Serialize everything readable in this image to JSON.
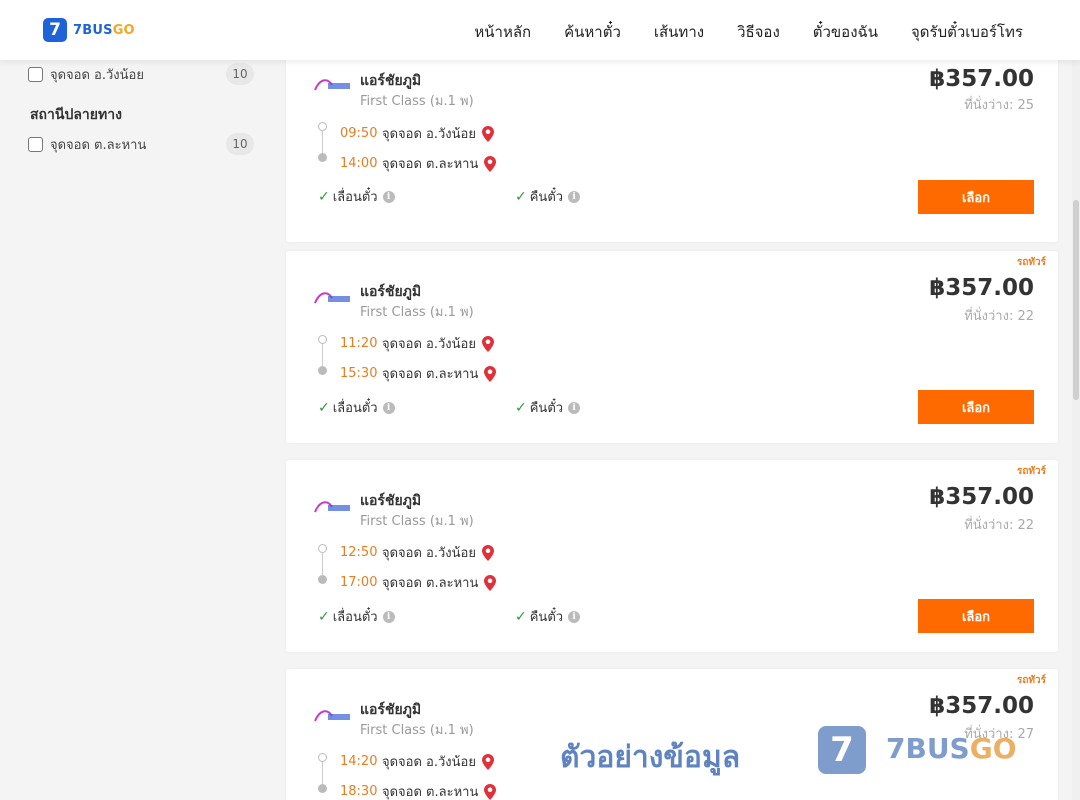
{
  "header": {
    "logo_mark": "7",
    "logo_text": "7BUS",
    "logo_text_accent": "GO",
    "nav": [
      "หน้าหลัก",
      "ค้นหาตั๋ว",
      "เส้นทาง",
      "วิธีจอง",
      "ตั๋วของฉัน",
      "จุดรับตั๋วเบอร์โทร"
    ]
  },
  "sidebar": {
    "origin_item": {
      "label": "จุดจอด อ.วังน้อย",
      "count": "10"
    },
    "destination_title": "สถานีปลายทาง",
    "destination_item": {
      "label": "จุดจอด ต.ละหาน",
      "count": "10"
    }
  },
  "cards": [
    {
      "operator": "แอร์ชัยภูมิ",
      "class": "First Class (ม.1 พ)",
      "tag": "",
      "price": "฿357.00",
      "seats": "ที่นั่งว่าง: 25",
      "dep_time": "09:50",
      "dep_place": "จุดจอด อ.วังน้อย",
      "arr_time": "14:00",
      "arr_place": "จุดจอด ต.ละหาน",
      "feature1": "เลื่อนตั๋ว",
      "feature2": "คืนตั๋ว",
      "button": "เลือก"
    },
    {
      "operator": "แอร์ชัยภูมิ",
      "class": "First Class (ม.1 พ)",
      "tag": "รถทัวร์",
      "price": "฿357.00",
      "seats": "ที่นั่งว่าง: 22",
      "dep_time": "11:20",
      "dep_place": "จุดจอด อ.วังน้อย",
      "arr_time": "15:30",
      "arr_place": "จุดจอด ต.ละหาน",
      "feature1": "เลื่อนตั๋ว",
      "feature2": "คืนตั๋ว",
      "button": "เลือก"
    },
    {
      "operator": "แอร์ชัยภูมิ",
      "class": "First Class (ม.1 พ)",
      "tag": "รถทัวร์",
      "price": "฿357.00",
      "seats": "ที่นั่งว่าง: 22",
      "dep_time": "12:50",
      "dep_place": "จุดจอด อ.วังน้อย",
      "arr_time": "17:00",
      "arr_place": "จุดจอด ต.ละหาน",
      "feature1": "เลื่อนตั๋ว",
      "feature2": "คืนตั๋ว",
      "button": "เลือก"
    },
    {
      "operator": "แอร์ชัยภูมิ",
      "class": "First Class (ม.1 พ)",
      "tag": "รถทัวร์",
      "price": "฿357.00",
      "seats": "ที่นั่งว่าง: 27",
      "dep_time": "14:20",
      "dep_place": "จุดจอด อ.วังน้อย",
      "arr_time": "18:30",
      "arr_place": "จุดจอด ต.ละหาน",
      "feature1": "",
      "feature2": "",
      "button": ""
    }
  ],
  "watermark": {
    "text": "ตัวอย่างข้อมูล",
    "logo_mark": "7",
    "brand": "7BUS",
    "brand_accent": "GO"
  },
  "colors": {
    "accent": "#ff6a00",
    "time": "#e67e22",
    "brand_blue": "#1f63d8",
    "check": "#2e9a3e"
  }
}
